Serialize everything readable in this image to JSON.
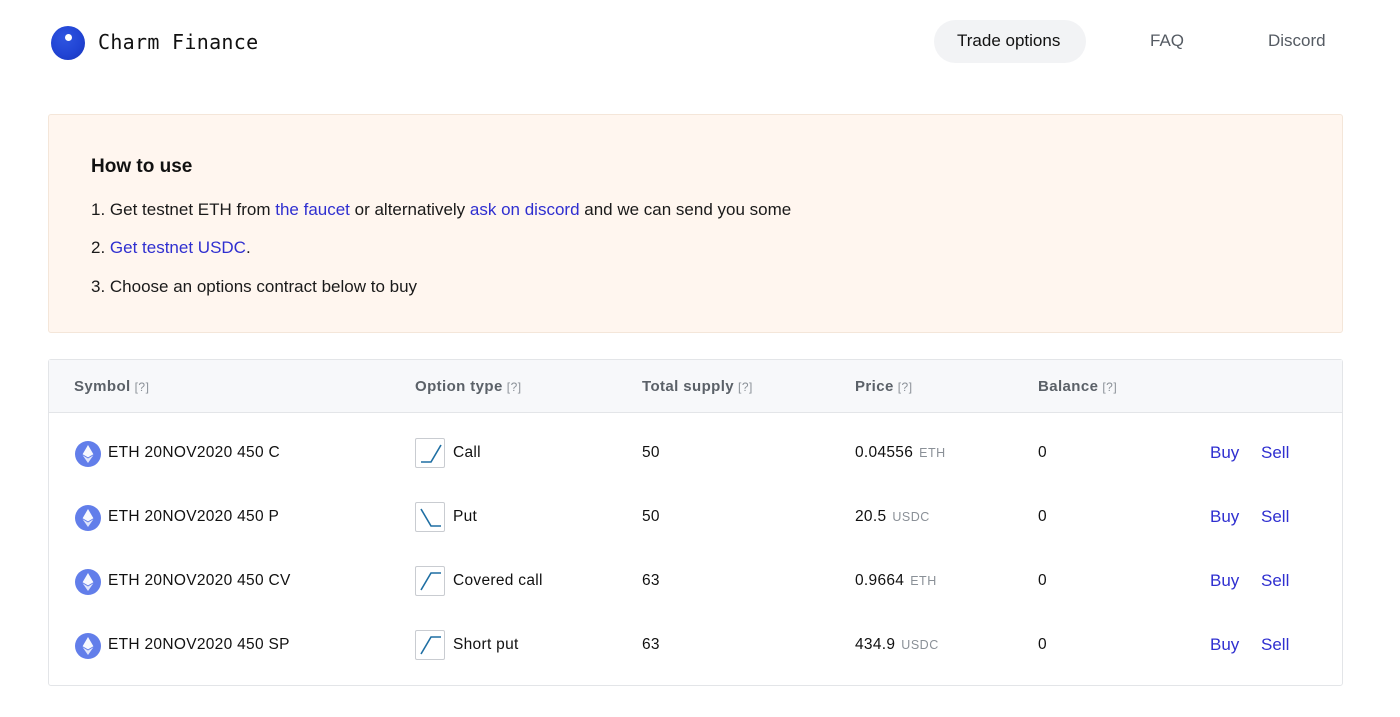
{
  "header": {
    "brand": "Charm Finance",
    "nav": {
      "trade": "Trade options",
      "faq": "FAQ",
      "discord": "Discord"
    }
  },
  "howto": {
    "title": "How to use",
    "step1": {
      "prefix": "1. Get testnet ETH from ",
      "link1": "the faucet",
      "middle": " or alternatively ",
      "link2": "ask on discord",
      "suffix": " and we can send you some"
    },
    "step2": {
      "prefix": "2. ",
      "link": "Get testnet USDC",
      "suffix": "."
    },
    "step3": "3. Choose an options contract below to buy"
  },
  "table": {
    "columns": {
      "symbol": "Symbol",
      "option_type": "Option type",
      "total_supply": "Total supply",
      "price": "Price",
      "balance": "Balance",
      "help": "[?]"
    },
    "rows": [
      {
        "symbol": "ETH 20NOV2020 450 C",
        "type": "Call",
        "type_icon": "call-payoff-icon",
        "supply": "50",
        "price": "0.04556",
        "unit": "ETH",
        "balance": "0",
        "buy": "Buy",
        "sell": "Sell"
      },
      {
        "symbol": "ETH 20NOV2020 450 P",
        "type": "Put",
        "type_icon": "put-payoff-icon",
        "supply": "50",
        "price": "20.5",
        "unit": "USDC",
        "balance": "0",
        "buy": "Buy",
        "sell": "Sell"
      },
      {
        "symbol": "ETH 20NOV2020 450 CV",
        "type": "Covered call",
        "type_icon": "covered-call-payoff-icon",
        "supply": "63",
        "price": "0.9664",
        "unit": "ETH",
        "balance": "0",
        "buy": "Buy",
        "sell": "Sell"
      },
      {
        "symbol": "ETH 20NOV2020 450 SP",
        "type": "Short put",
        "type_icon": "short-put-payoff-icon",
        "supply": "63",
        "price": "434.9",
        "unit": "USDC",
        "balance": "0",
        "buy": "Buy",
        "sell": "Sell"
      }
    ]
  },
  "colors": {
    "accent": "#2f2fd0",
    "logo": "#2144d4",
    "eth_icon": "#627eea",
    "howto_bg": "#fff6ef",
    "payoff_line": "#1f6fa3"
  }
}
